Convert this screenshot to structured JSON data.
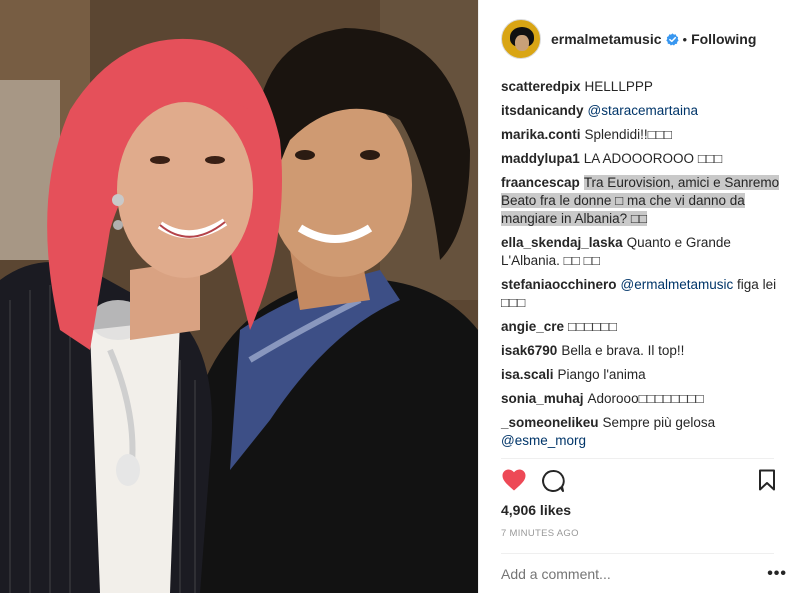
{
  "post": {
    "username": "ermalmetamusic",
    "separator": "•",
    "follow_state": "Following"
  },
  "comments": [
    {
      "user": "scatteredpix",
      "text": "HELLLPPP"
    },
    {
      "user": "itsdanicandy",
      "mention": "@staracemartaina"
    },
    {
      "user": "marika.conti",
      "text": "Splendidi!!□□□"
    },
    {
      "user": "maddylupa1",
      "text": "LA ADOOOROOO □□□"
    },
    {
      "user": "fraancescap",
      "text": "Tra Eurovision, amici e Sanremo Beato fra le donne □ ma che vi danno da mangiare in Albania? □□"
    },
    {
      "user": "ella_skendaj_laska",
      "text": "Quanto e Grande L'Albania. □□ □□"
    },
    {
      "user": "stefaniaocchinero",
      "mention": "@ermalmetamusic",
      "text": "figa lei □□□"
    },
    {
      "user": "angie_cre",
      "text": "□□□□□□"
    },
    {
      "user": "isak6790",
      "text": "Bella e brava. Il top!!"
    },
    {
      "user": "isa.scali",
      "text": "Piango l'anima"
    },
    {
      "user": "sonia_muhaj",
      "text": "Adorooo□□□□□□□□"
    },
    {
      "user": "_someonelikeu",
      "text": "Sempre più gelosa",
      "mention": "@esme_morg"
    }
  ],
  "likes": "4,906 likes",
  "time_ago": "7 MINUTES AGO",
  "add_comment_placeholder": "Add a comment...",
  "more_label": "•••",
  "colors": {
    "heart": "#ed4956",
    "verified": "#3897f0",
    "mention": "#003569",
    "muted": "#999999"
  },
  "icons": [
    "verified-icon",
    "heart-icon",
    "comment-icon",
    "bookmark-icon",
    "more-options-icon"
  ]
}
